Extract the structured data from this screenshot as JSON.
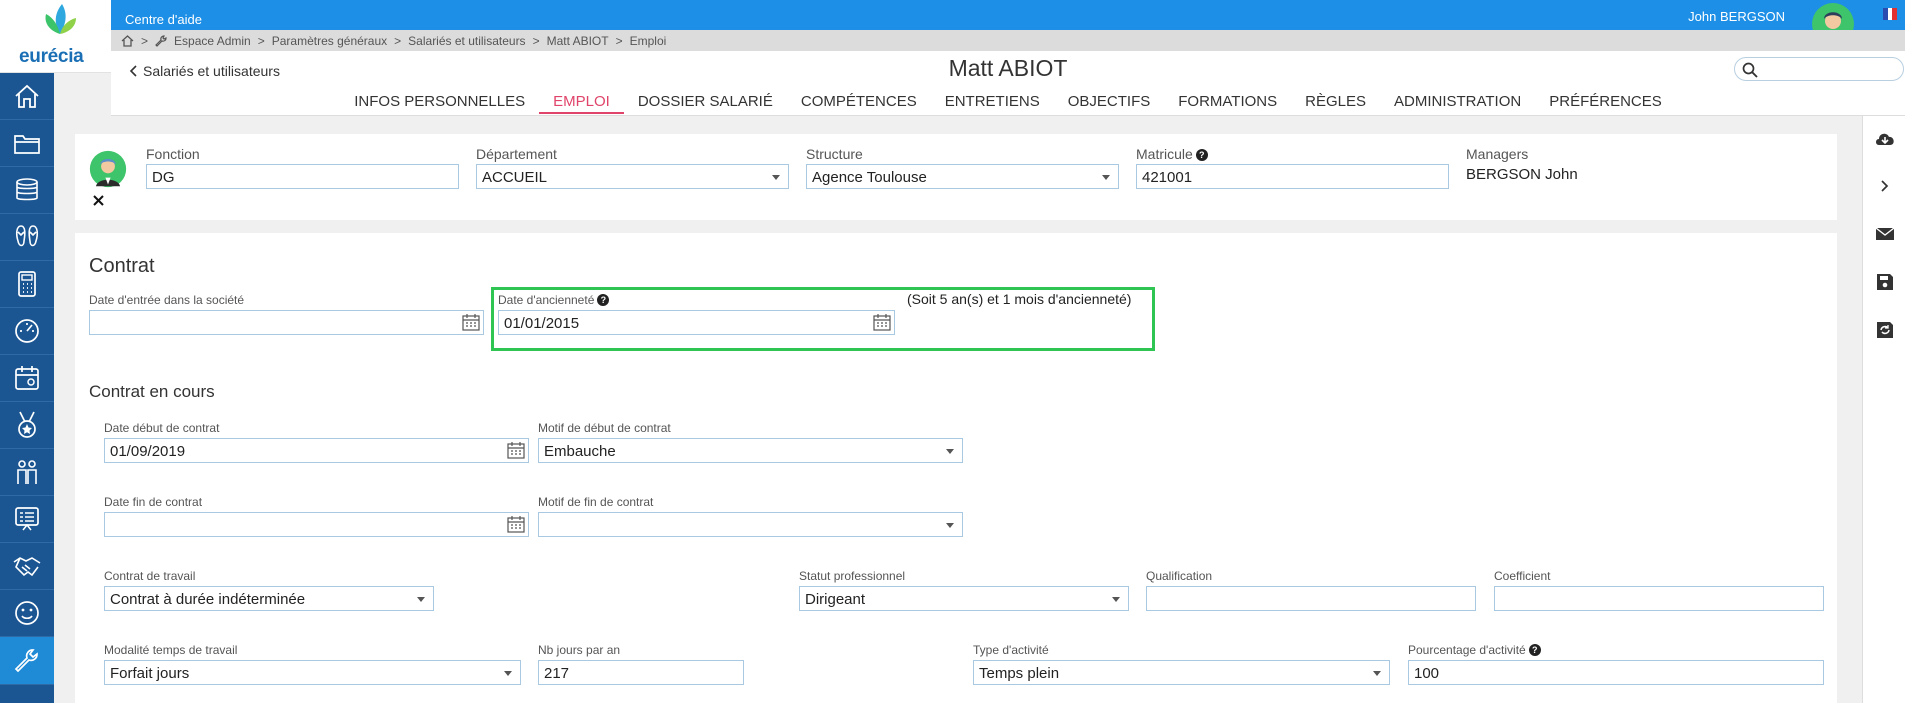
{
  "brand": {
    "name": "eurécia"
  },
  "topbar": {
    "help": "Centre d'aide",
    "user": "John  BERGSON"
  },
  "breadcrumb": {
    "sep": ">",
    "items": [
      "Espace Admin",
      "Paramètres généraux",
      "Salariés et utilisateurs",
      "Matt ABIOT",
      "Emploi"
    ]
  },
  "header": {
    "back": "Salariés et utilisateurs",
    "title": "Matt ABIOT",
    "search_placeholder": ""
  },
  "tabs": [
    "INFOS PERSONNELLES",
    "EMPLOI",
    "DOSSIER SALARIÉ",
    "COMPÉTENCES",
    "ENTRETIENS",
    "OBJECTIFS",
    "FORMATIONS",
    "RÈGLES",
    "ADMINISTRATION",
    "PRÉFÉRENCES"
  ],
  "active_tab": "EMPLOI",
  "sidebar": [
    "home-icon",
    "folder-icon",
    "coins-icon",
    "sandals-icon",
    "calculator-icon",
    "gauge-icon",
    "calendar-icon",
    "medal-icon",
    "people-icon",
    "board-icon",
    "handshake-icon",
    "smiley-icon",
    "wrench-icon"
  ],
  "rightbar": [
    "cloud-download-icon",
    "chevron-right-icon",
    "mail-icon",
    "save-icon",
    "save-refresh-icon"
  ],
  "employee": {
    "fonction_label": "Fonction",
    "fonction": "DG",
    "departement_label": "Département",
    "departement": "ACCUEIL",
    "structure_label": "Structure",
    "structure": "Agence Toulouse",
    "matricule_label": "Matricule",
    "matricule": "421001",
    "managers_label": "Managers",
    "managers": "BERGSON John"
  },
  "contrat": {
    "title": "Contrat",
    "entree_label": "Date d'entrée dans la société",
    "entree": "",
    "anciennete_label": "Date d'ancienneté",
    "anciennete": "01/01/2015",
    "anciennete_note": "(Soit 5 an(s) et 1 mois d'ancienneté)"
  },
  "en_cours": {
    "title": "Contrat en cours",
    "debut_label": "Date début de contrat",
    "debut": "01/09/2019",
    "motif_debut_label": "Motif de début de contrat",
    "motif_debut": "Embauche",
    "fin_label": "Date fin de contrat",
    "fin": "",
    "motif_fin_label": "Motif de fin de contrat",
    "motif_fin": "",
    "travail_label": "Contrat de travail",
    "travail": "Contrat à durée indéterminée",
    "statut_label": "Statut professionnel",
    "statut": "Dirigeant",
    "qualification_label": "Qualification",
    "qualification": "",
    "coefficient_label": "Coefficient",
    "coefficient": "",
    "modalite_label": "Modalité temps de travail",
    "modalite": "Forfait jours",
    "nbjours_label": "Nb jours par an",
    "nbjours": "217",
    "activite_label": "Type d'activité",
    "activite": "Temps plein",
    "pourcentage_label": "Pourcentage d'activité",
    "pourcentage": "100"
  },
  "colors": {
    "topbar": "#1d8fe6",
    "sidebar": "#1b5693",
    "accent": "#e0446a",
    "highlight": "#2ec552"
  }
}
